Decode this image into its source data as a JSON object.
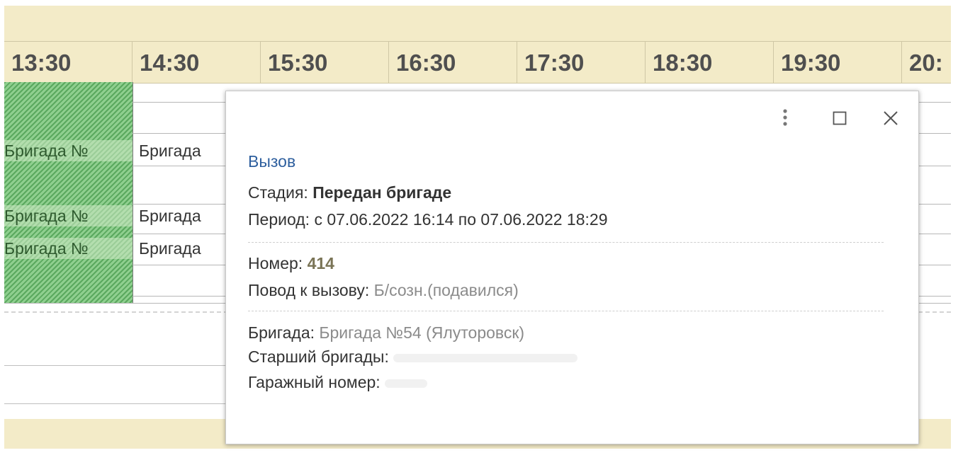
{
  "schedule": {
    "times": [
      "13:30",
      "14:30",
      "15:30",
      "16:30",
      "17:30",
      "18:30",
      "19:30",
      "20:"
    ],
    "rows": [
      {
        "busy_label": "Бригада №",
        "label": "Бригада"
      },
      {
        "busy_label": "Бригада №",
        "label": "Бригада"
      },
      {
        "busy_label": "Бригада №",
        "label": "Бригада"
      }
    ]
  },
  "popup": {
    "title": "Вызов",
    "stage": {
      "label": "Стадия:",
      "value": "Передан бригаде"
    },
    "period": {
      "label": "Период:",
      "value": "с 07.06.2022 16:14 по 07.06.2022 18:29"
    },
    "number": {
      "label": "Номер:",
      "value": "414"
    },
    "reason": {
      "label": "Повод к вызову:",
      "value": "Б/созн.(подавился)"
    },
    "brigade": {
      "label": "Бригада:",
      "value": "Бригада №54 (Ялуторовск)"
    },
    "senior": {
      "label": "Старший бригады:",
      "value": ""
    },
    "garage": {
      "label": "Гаражный номер:",
      "value": ""
    },
    "icons": [
      "more-vertical-icon",
      "maximize-icon",
      "close-icon"
    ]
  },
  "colors": {
    "header_bg": "#f3ebc8",
    "busy_stripe": "#5aa85e",
    "link": "#2e5f9e"
  }
}
